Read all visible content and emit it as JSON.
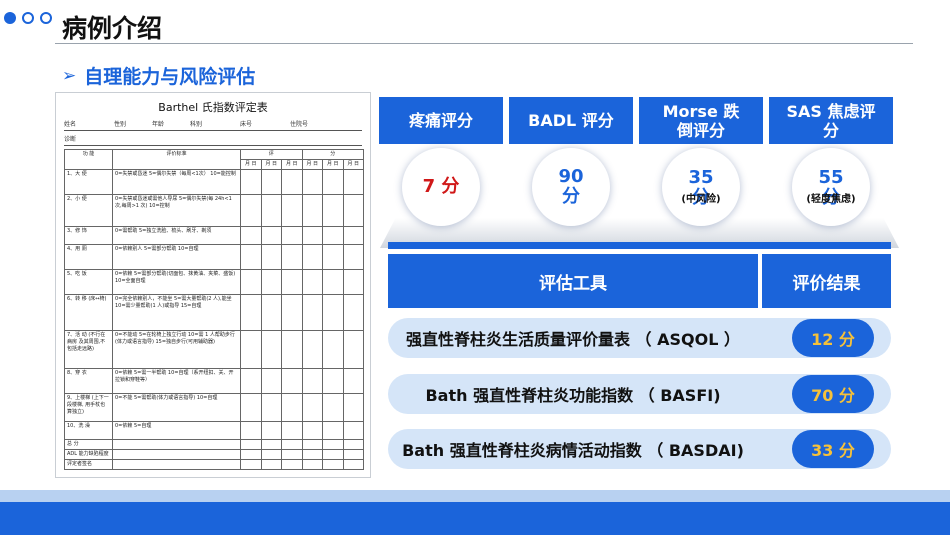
{
  "header": {
    "title": "病例介绍",
    "subtitle_marker": "➢",
    "subtitle": "自理能力与风险评估"
  },
  "colors": {
    "brand": "#1b64da",
    "accent_red": "#d01818",
    "result_text": "#f5c13a",
    "pill": "#d5e5f8"
  },
  "form": {
    "title": "Barthel 氏指数评定表",
    "meta": [
      "姓名",
      "性别",
      "年龄",
      "科别",
      "床号",
      "住院号"
    ],
    "diag": "诊断",
    "head": {
      "item": "功 能",
      "std": "评价标准",
      "score": "评",
      "score2": "分",
      "dates": [
        "月 日",
        "月 日",
        "月 日",
        "月 日",
        "月 日",
        "月 日"
      ]
    },
    "rows": [
      {
        "item": "1、大 便",
        "std": "0=失禁或昏迷 5=偶尔失禁（每周<1次） 10=能控制"
      },
      {
        "item": "2、小 便",
        "std": "0=失禁或昏迷或需他人导尿 5=偶尔失禁(每 24h<1 次,每周>1 次) 10=控制"
      },
      {
        "item": "3、修 饰",
        "std": "0=需帮助 5=独立洗脸、梳头、刷牙、剃须"
      },
      {
        "item": "4、用 厕",
        "std": "0=依赖别人 5=需部分帮助 10=自理"
      },
      {
        "item": "5、吃 饭",
        "std": "0=依赖 5=需部分帮助(切面包、抹黄油、夹菜、盛饭) 10=全面自理"
      },
      {
        "item": "6、转 移 (床↔椅)",
        "std": "0=完全依赖别人，不能坐 5=需大量帮助(2 人),能坐 10=需少量帮助(1 人)或指导 15=自理"
      },
      {
        "item": "7、活 动 (不行在病房 及其周围,不 包括走远路)",
        "std": "0=不能动 5=在轮椅上独立行动 10=需 1 人帮助步行(体力或语言指导) 15=独自步行(可用辅助器)"
      },
      {
        "item": "8、穿 衣",
        "std": "0=依赖 5=需一半帮助 10=自理（系开纽扣、关、开拉锁和穿鞋等）"
      },
      {
        "item": "9、上楼梯 (上下一段楼梯, 用手杖也算独立)",
        "std": "0=不能 5=需帮助(体力或语言指导) 10=自理"
      },
      {
        "item": "10、洗 澡",
        "std": "0=依赖 5=自理"
      },
      {
        "item": "总 分",
        "std": ""
      },
      {
        "item": "ADL 能力缺陷程度",
        "std": ""
      },
      {
        "item": "评定者签名",
        "std": ""
      }
    ]
  },
  "scores": [
    {
      "label": "疼痛评分",
      "value": "7 分",
      "note": ""
    },
    {
      "label": "BADL 评分",
      "value": "90 分",
      "note": ""
    },
    {
      "label": "Morse 跌倒评分",
      "value": "35 分",
      "note": "(中风险)"
    },
    {
      "label": "SAS 焦虑评分",
      "value": "55 分",
      "note": "(轻度焦虑)"
    }
  ],
  "eval_table": {
    "col_tool": "评估工具",
    "col_result": "评价结果",
    "rows": [
      {
        "tool": "强直性脊柱炎生活质量评价量表 （ ASQOL ）",
        "result": "12 分"
      },
      {
        "tool": "Bath 强直性脊柱炎功能指数 （ BASFI)",
        "result": "70 分"
      },
      {
        "tool": "Bath 强直性脊柱炎病情活动指数 （ BASDAI)",
        "result": "33 分"
      }
    ]
  }
}
